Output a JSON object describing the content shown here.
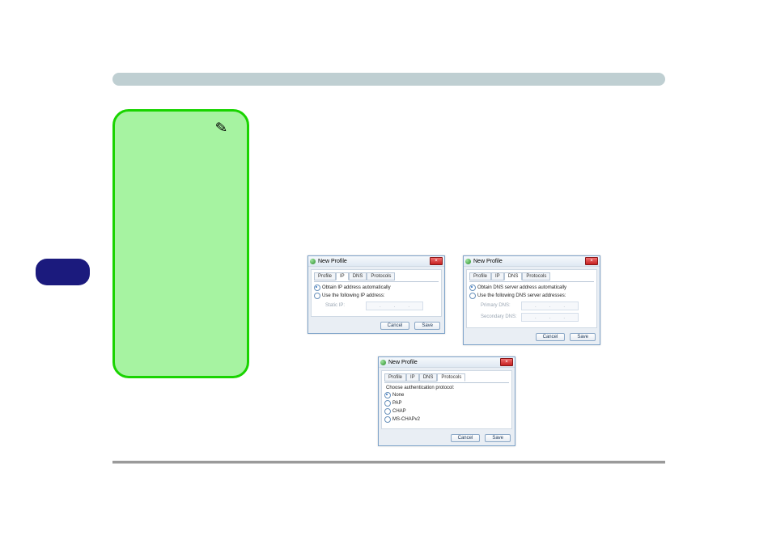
{
  "dialog": {
    "title": "New Profile",
    "close_glyph": "×",
    "buttons": {
      "cancel": "Cancel",
      "save": "Save"
    },
    "tabs": {
      "profile": "Profile",
      "ip": "IP",
      "dns": "DNS",
      "protocols": "Protocols"
    }
  },
  "ip_tab": {
    "opt_auto": "Obtain IP address automatically",
    "opt_manual": "Use the following IP address:",
    "static_label": "Static IP:"
  },
  "dns_tab": {
    "opt_auto": "Obtain DNS server address automatically",
    "opt_manual": "Use the following DNS server addresses:",
    "primary_label": "Primary DNS:",
    "secondary_label": "Secondary DNS:"
  },
  "protocols_tab": {
    "heading": "Choose authentication protocol:",
    "options": {
      "none": "None",
      "pap": "PAP",
      "chap": "CHAP",
      "mschapv2": "MS-CHAPv2"
    }
  }
}
